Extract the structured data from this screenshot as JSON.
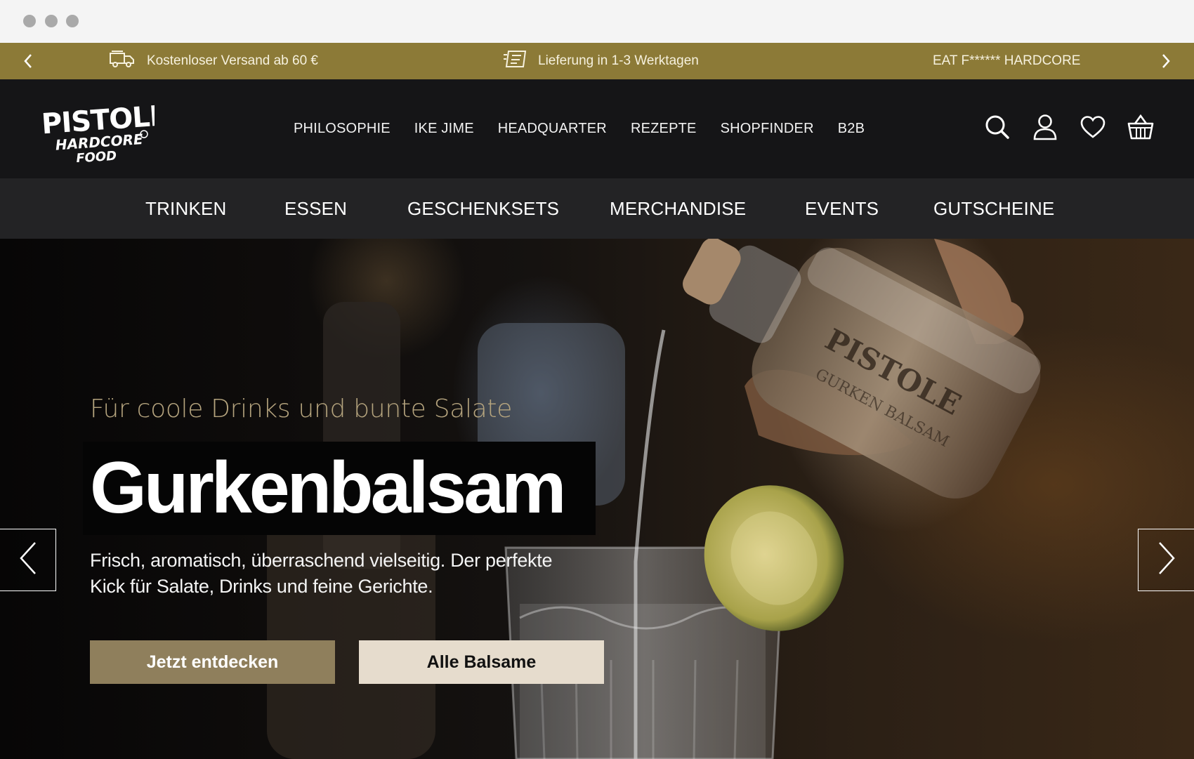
{
  "announcement": {
    "items": [
      {
        "icon": "truck-icon",
        "text": "Kostenloser Versand ab 60 €"
      },
      {
        "icon": "delivery-box-icon",
        "text": "Lieferung in 1-3 Werktagen"
      },
      {
        "icon": "",
        "text": "EAT F****** HARDCORE"
      }
    ],
    "background": "#8c7a37"
  },
  "header": {
    "logo": {
      "line1": "PISTOLE",
      "line2": "HARDCORE",
      "line3": "FOOD"
    },
    "nav": [
      "PHILOSOPHIE",
      "IKE JIME",
      "HEADQUARTER",
      "REZEPTE",
      "SHOPFINDER",
      "B2B"
    ],
    "icons": [
      "search-icon",
      "account-icon",
      "heart-icon",
      "basket-icon"
    ]
  },
  "categories": [
    "TRINKEN",
    "ESSEN",
    "GESCHENKSETS",
    "MERCHANDISE",
    "EVENTS",
    "GUTSCHEINE"
  ],
  "hero": {
    "subtitle": "Für coole Drinks und bunte Salate",
    "title": "Gurkenbalsam",
    "description": "Frisch, aromatisch, überraschend vielseitig. Der perfekte Kick für Salate, Drinks und feine Gerichte.",
    "primary_button": "Jetzt entdecken",
    "secondary_button": "Alle Balsame",
    "bottle_label": "PISTOLE",
    "bottle_sublabel": "GURKEN BALSAM",
    "colors": {
      "primary_button": "#8f7f5c",
      "secondary_button": "#e6dccd",
      "subtitle": "#b5a47e"
    }
  }
}
